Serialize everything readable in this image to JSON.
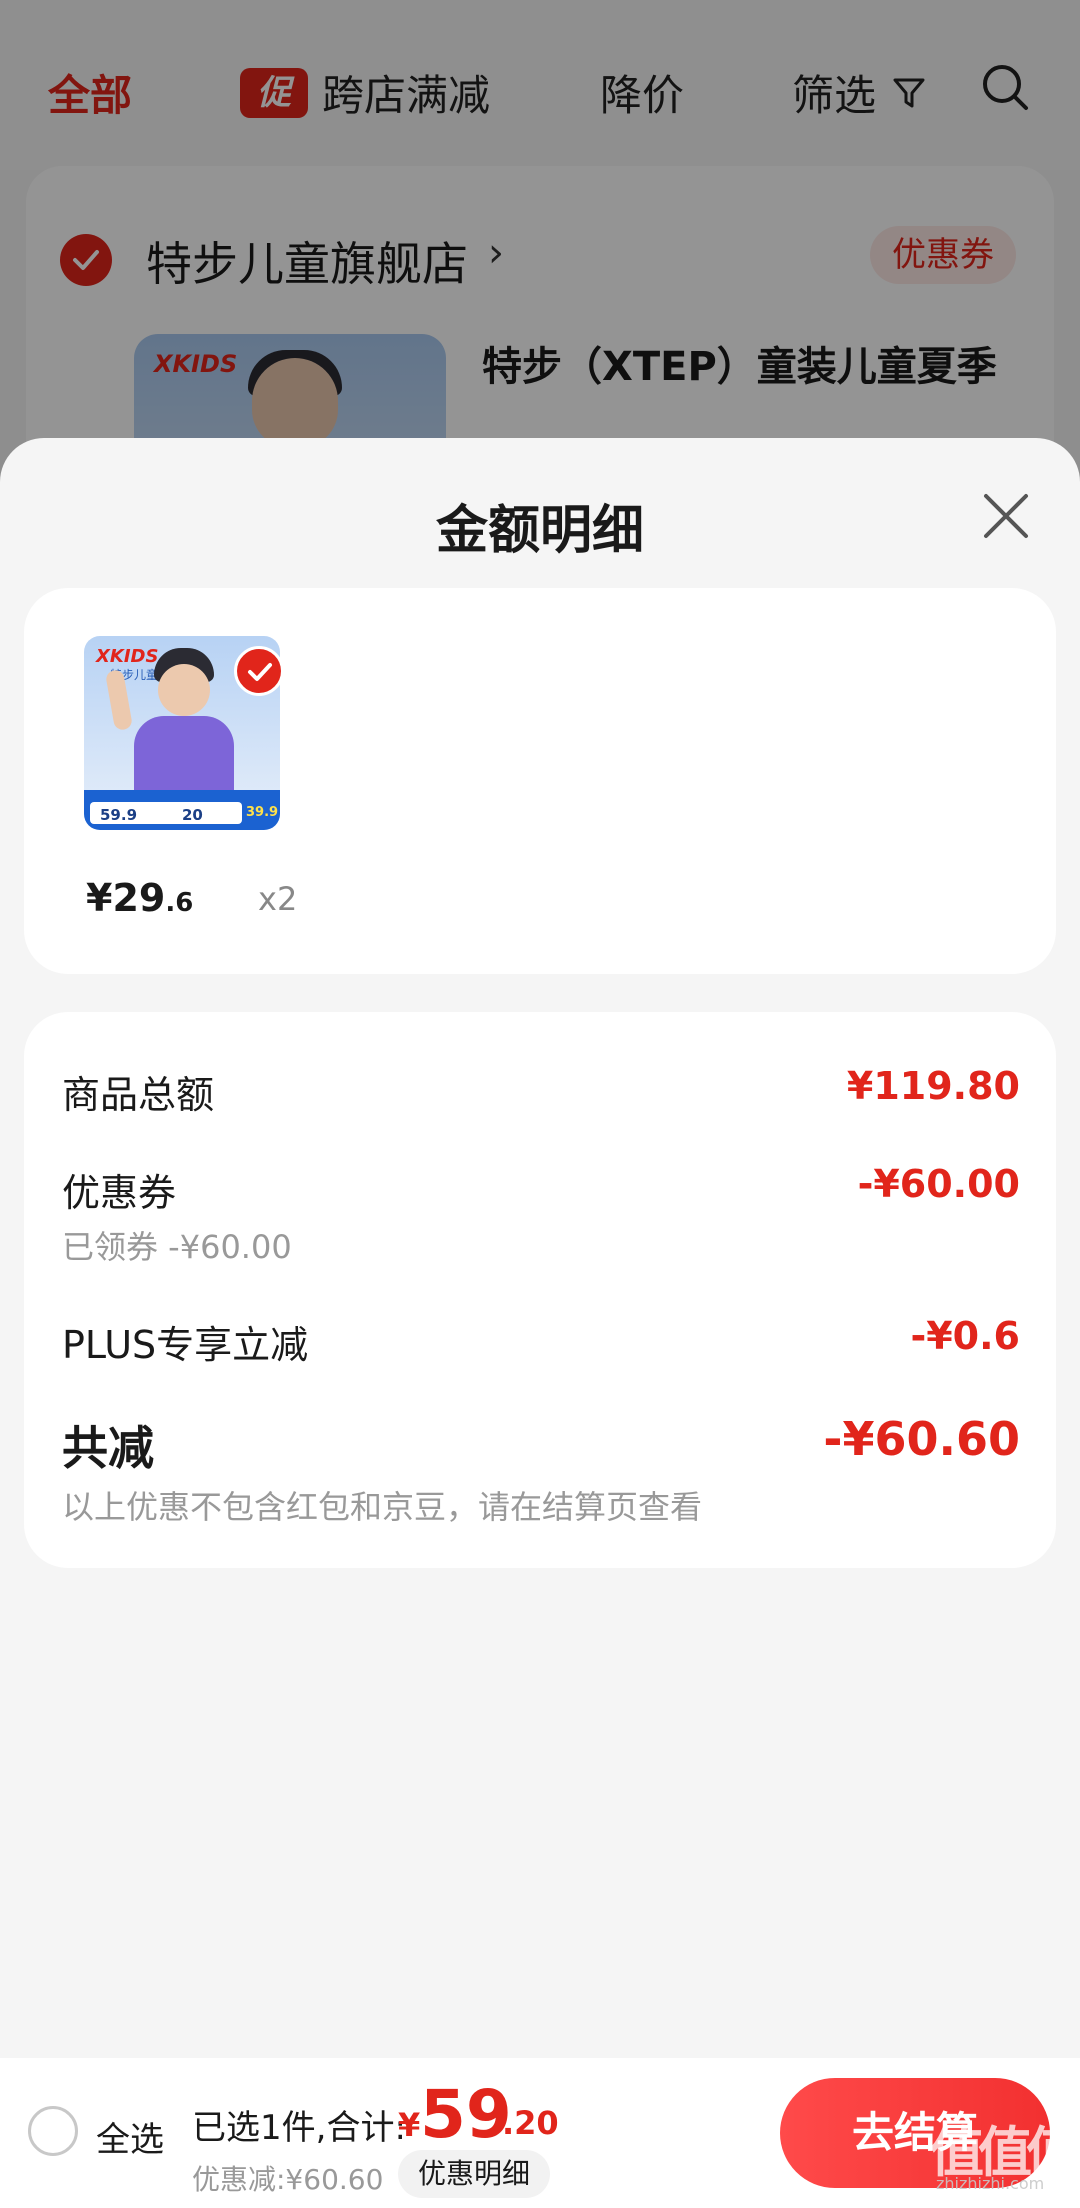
{
  "background": {
    "tabs": [
      {
        "label": "全部",
        "active": true
      },
      {
        "label": "跨店满减",
        "badge": "促"
      },
      {
        "label": "降价"
      },
      {
        "label": "筛选"
      }
    ],
    "store": {
      "name": "特步儿童旗舰店",
      "coupon_tag": "优惠券",
      "thumb_brand": "XKIDS",
      "product_title": "特步（XTEP）童装儿童夏季"
    }
  },
  "sheet": {
    "title": "金额明细",
    "item": {
      "thumb_brand": "XKIDS",
      "thumb_brand_sub": "特步儿童",
      "thumb_prices": [
        "59.9",
        "20",
        "39.9"
      ],
      "price_symbol": "¥",
      "price_int": "29",
      "price_dec": ".6",
      "quantity": "x2"
    },
    "breakdown": {
      "goods_total_label": "商品总额",
      "goods_total_value": "¥119.80",
      "coupon_label": "优惠券",
      "coupon_value": "-¥60.00",
      "coupon_sub": "已领券 -¥60.00",
      "plus_label": "PLUS专享立减",
      "plus_value": "-¥0.6",
      "total_discount_label": "共减",
      "total_discount_value": "-¥60.60",
      "note": "以上优惠不包含红包和京豆，请在结算页查看"
    }
  },
  "bottom_bar": {
    "select_all": "全选",
    "selected": "已选1件,合计:",
    "total_symbol": "¥",
    "total_int": "59",
    "total_dec": ".20",
    "discount": "优惠减:¥60.60",
    "detail_button": "优惠明细",
    "checkout": "去结算"
  },
  "watermark": {
    "logo": "值值值",
    "site": "zhizhizhi.com"
  },
  "colors": {
    "accent": "#e1251b",
    "checkout_gradient": [
      "#ff4a4a",
      "#f23030"
    ]
  },
  "icons": [
    "filter-icon",
    "search-icon",
    "check-icon",
    "close-icon",
    "chevron-right-icon"
  ]
}
